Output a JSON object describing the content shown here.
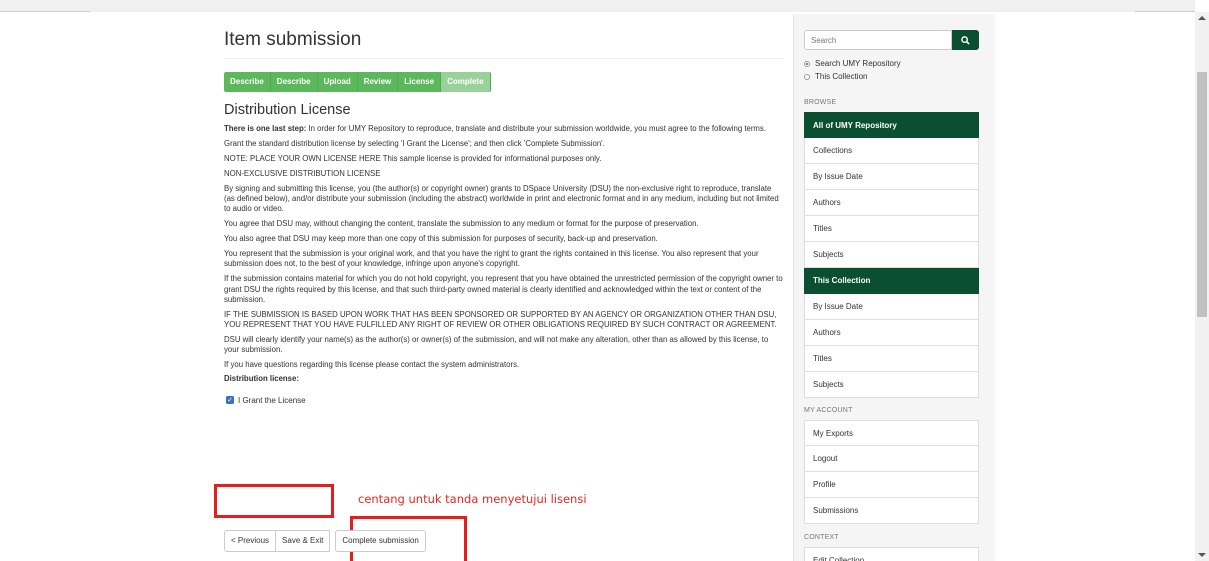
{
  "main": {
    "title": "Item submission",
    "progress": [
      "Describe",
      "Describe",
      "Upload",
      "Review",
      "License",
      "Complete"
    ],
    "section_title": "Distribution License",
    "intro_bold": "There is one last step:",
    "intro_rest": " In order for UMY Repository to reproduce, translate and distribute your submission worldwide, you must agree to the following terms.",
    "paragraphs": [
      "Grant the standard distribution license by selecting 'I Grant the License'; and then click 'Complete Submission'.",
      "NOTE: PLACE YOUR OWN LICENSE HERE This sample license is provided for informational purposes only.",
      "NON-EXCLUSIVE DISTRIBUTION LICENSE",
      "By signing and submitting this license, you (the author(s) or copyright owner) grants to DSpace University (DSU) the non-exclusive right to reproduce, translate (as defined below), and/or distribute your submission (including the abstract) worldwide in print and electronic format and in any medium, including but not limited to audio or video.",
      "You agree that DSU may, without changing the content, translate the submission to any medium or format for the purpose of preservation.",
      "You also agree that DSU may keep more than one copy of this submission for purposes of security, back-up and preservation.",
      "You represent that the submission is your original work, and that you have the right to grant the rights contained in this license. You also represent that your submission does not, to the best of your knowledge, infringe upon anyone's copyright.",
      "If the submission contains material for which you do not hold copyright, you represent that you have obtained the unrestricted permission of the copyright owner to grant DSU the rights required by this license, and that such third-party owned material is clearly identified and acknowledged within the text or content of the submission.",
      "IF THE SUBMISSION IS BASED UPON WORK THAT HAS BEEN SPONSORED OR SUPPORTED BY AN AGENCY OR ORGANIZATION OTHER THAN DSU, YOU REPRESENT THAT YOU HAVE FULFILLED ANY RIGHT OF REVIEW OR OTHER OBLIGATIONS REQUIRED BY SUCH CONTRACT OR AGREEMENT.",
      "DSU will clearly identify your name(s) as the author(s) or owner(s) of the submission, and will not make any alteration, other than as allowed by this license, to your submission.",
      "If you have questions regarding this license please contact the system administrators."
    ],
    "license_label": "Distribution license:",
    "grant_label": "I Grant the License",
    "annotation": "centang untuk tanda menyetujui lisensi",
    "buttons": {
      "previous": "< Previous",
      "save_exit": "Save & Exit",
      "complete": "Complete submission"
    }
  },
  "sidebar": {
    "search_placeholder": "Search",
    "scope_options": [
      "Search UMY Repository",
      "This Collection"
    ],
    "browse_heading": "BROWSE",
    "browse_items": [
      "All of UMY Repository",
      "Collections",
      "By Issue Date",
      "Authors",
      "Titles",
      "Subjects",
      "This Collection",
      "By Issue Date",
      "Authors",
      "Titles",
      "Subjects"
    ],
    "account_heading": "MY ACCOUNT",
    "account_items": [
      "My Exports",
      "Logout",
      "Profile",
      "Submissions"
    ],
    "context_heading": "CONTEXT",
    "context_items": [
      "Edit Collection"
    ]
  },
  "colors": {
    "accent_green": "#0b4f31",
    "progress_green": "#5cb85c",
    "annotation_red": "#e61d1d"
  }
}
